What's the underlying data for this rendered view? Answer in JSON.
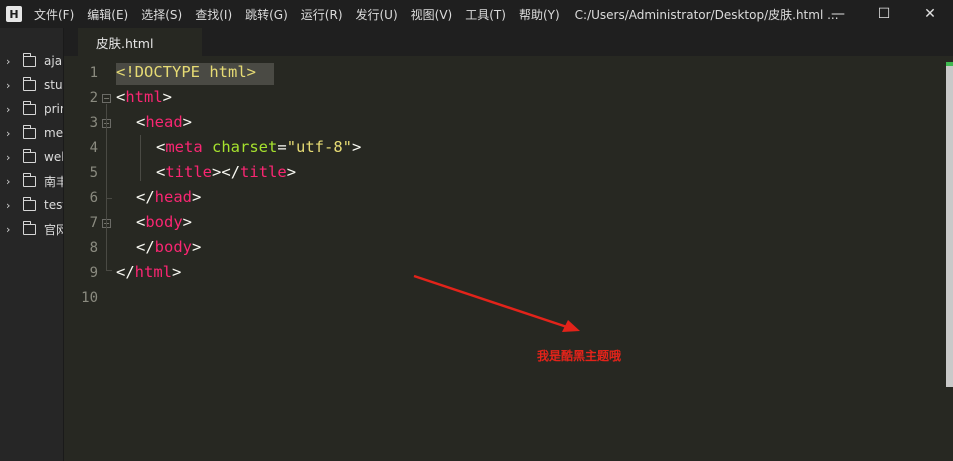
{
  "titlebar": {
    "logo_letter": "H",
    "menus": [
      "文件(F)",
      "编辑(E)",
      "选择(S)",
      "查找(I)",
      "跳转(G)",
      "运行(R)",
      "发行(U)",
      "视图(V)",
      "工具(T)",
      "帮助(Y)"
    ],
    "path": "C:/Users/Administrator/Desktop/皮肤.html ...",
    "controls": {
      "minimize": "—",
      "maximize": "☐",
      "close": "✕"
    }
  },
  "sidebar": {
    "items": [
      "aja",
      "stud",
      "prin",
      "me",
      "wel",
      "南丰",
      "test",
      "官网"
    ],
    "chevron": "›"
  },
  "tab": {
    "label": "皮肤.html"
  },
  "editor": {
    "lines": [
      "1",
      "2",
      "3",
      "4",
      "5",
      "6",
      "7",
      "8",
      "9",
      "10"
    ],
    "fold_marker": "−",
    "code": {
      "l1_doctype": "<!DOCTYPE html>",
      "open_lt": "<",
      "gt": ">",
      "close_lt": "</",
      "html": "html",
      "head": "head",
      "meta": "meta",
      "charset_attr": "charset",
      "eq": "=",
      "charset_val": "\"utf-8\"",
      "title": "title",
      "body": "body"
    }
  },
  "annotation": {
    "text": "我是酷黑主题哦",
    "color": "#e2231a"
  },
  "colors": {
    "background": "#272822",
    "tag": "#f92672",
    "attribute": "#a6e22e",
    "string": "#e6db74",
    "punctuation": "#f8f8f2"
  }
}
